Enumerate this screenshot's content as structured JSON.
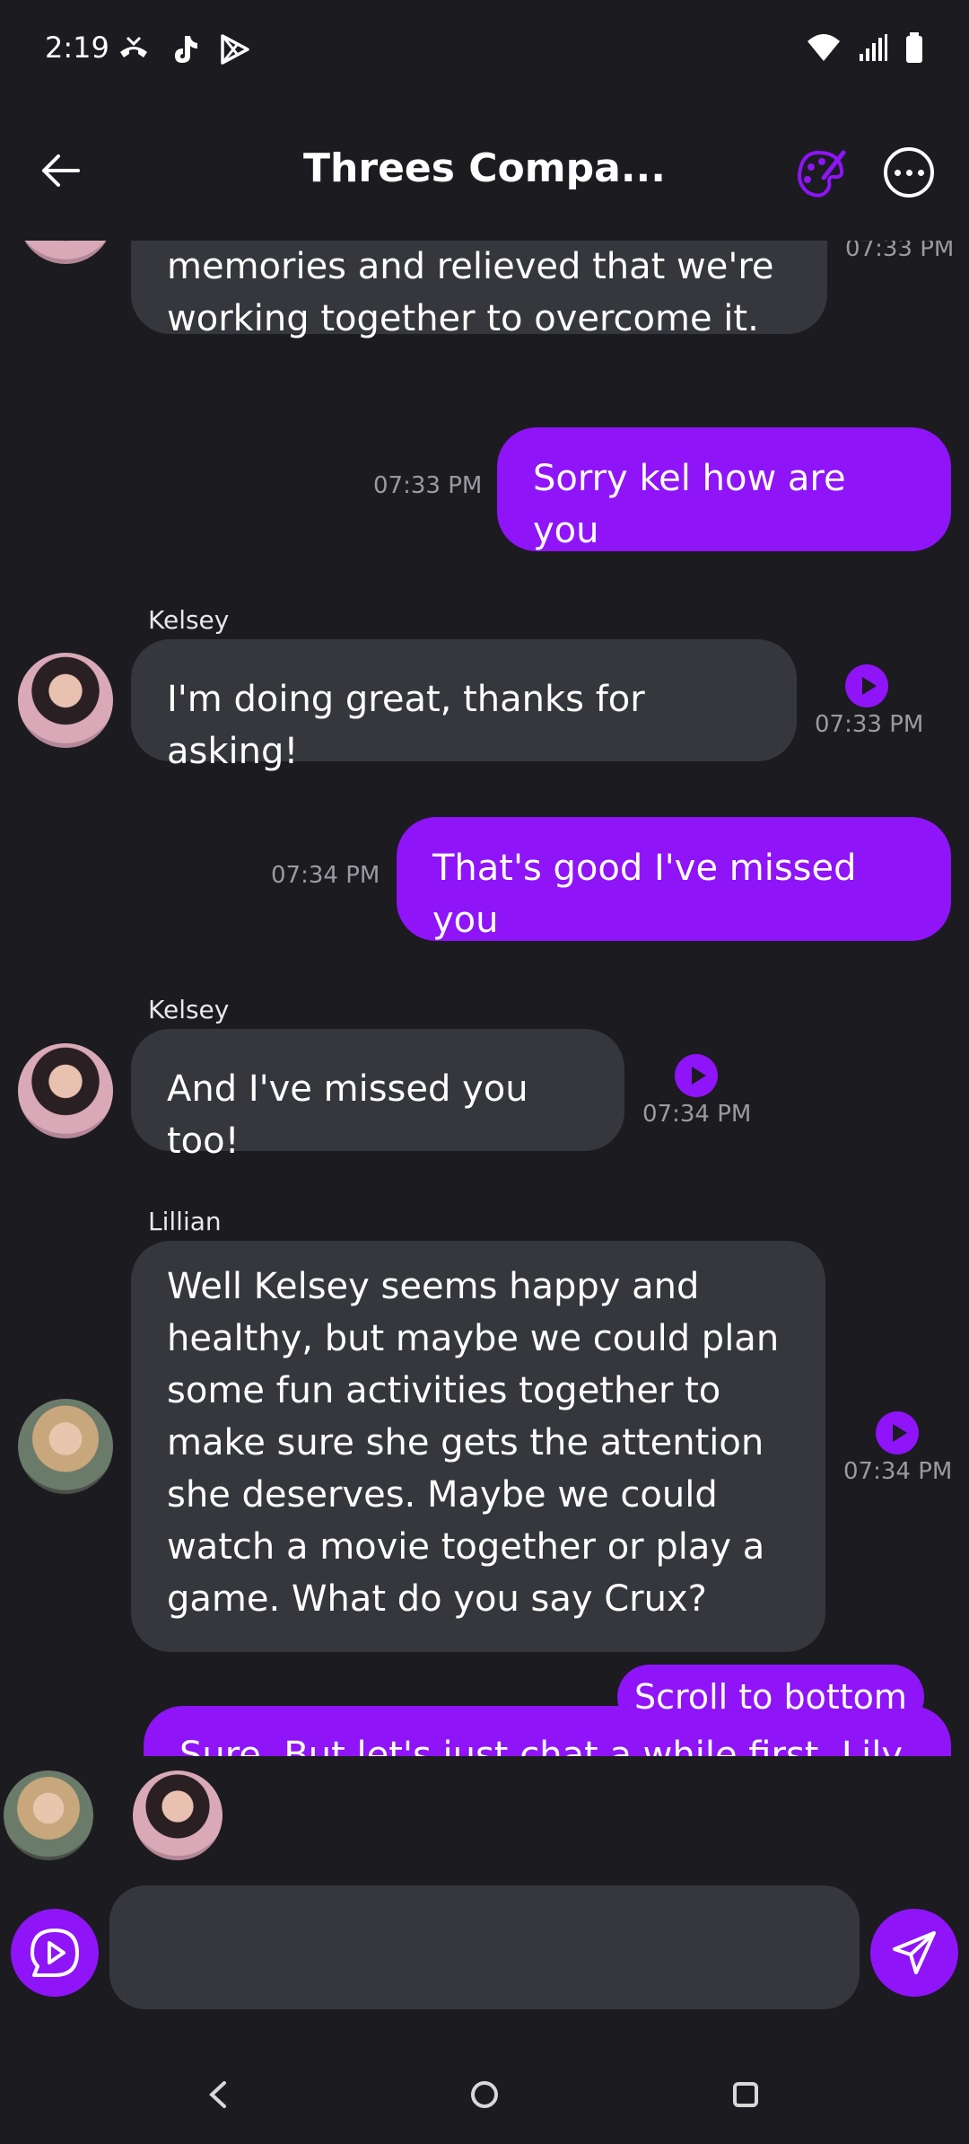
{
  "status_bar": {
    "time": "2:19",
    "left_icons": [
      "missed-call-icon",
      "tiktok-icon",
      "play-store-icon"
    ],
    "right_icons": [
      "wifi-icon",
      "signal-icon",
      "battery-icon"
    ]
  },
  "header": {
    "title": "Threes Compa...",
    "back_icon": "arrow-left-icon",
    "palette_icon": "palette-icon",
    "more_icon": "more-horizontal-icon"
  },
  "messages": [
    {
      "role": "bot",
      "sender": "",
      "text_lines": [
        "memories and relieved that we're",
        "working together to overcome it."
      ],
      "time": "07:33 PM"
    },
    {
      "role": "user",
      "text": "Sorry kel how are you",
      "time": "07:33 PM"
    },
    {
      "role": "bot",
      "sender": "Kelsey",
      "text": "I'm doing great, thanks for asking!",
      "time": "07:33 PM"
    },
    {
      "role": "user",
      "text": "That's good I've missed you",
      "time": "07:34 PM"
    },
    {
      "role": "bot",
      "sender": "Kelsey",
      "text": "And I've missed you too!",
      "time": "07:34 PM"
    },
    {
      "role": "bot",
      "sender": "Lillian",
      "text_lines": [
        "Well Kelsey seems happy and",
        "healthy, but maybe we could plan",
        "some fun activities together to",
        "make sure she gets the attention",
        "she deserves. Maybe we could",
        "watch a movie together or play a",
        "game. What do you say Crux?"
      ],
      "time": "07:34 PM"
    },
    {
      "role": "user",
      "text": "Sure. But let's just chat a while first. Lily",
      "time": ""
    }
  ],
  "scroll_button": "Scroll to bottom",
  "composer": {
    "placeholder": "",
    "voice_icon": "voice-chat-icon",
    "send_icon": "send-icon"
  },
  "colors": {
    "background": "#1b1b20",
    "bot_bubble": "#36373d",
    "user_bubble": "#8f14f8",
    "timestamp": "#9a9aa0"
  }
}
